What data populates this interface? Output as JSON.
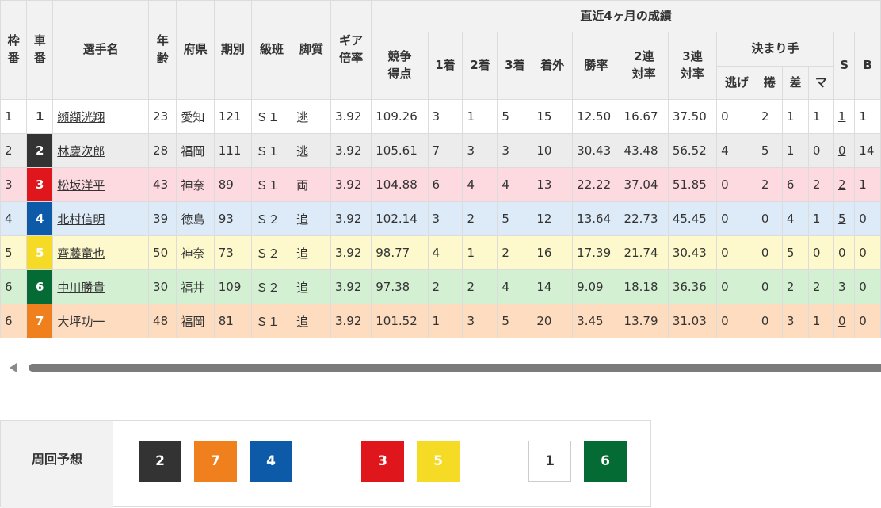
{
  "headers": {
    "waku": "枠番",
    "sha": "車番",
    "name": "選手名",
    "age": "年齢",
    "pref": "府県",
    "term": "期別",
    "class": "級班",
    "style": "脚質",
    "gear": "ギア倍率",
    "recent": "直近4ヶ月の成績",
    "score": "競争得点",
    "first": "1着",
    "second": "2着",
    "third": "3着",
    "out": "着外",
    "winrate": "勝率",
    "rentai2": "2連対率",
    "rentai3": "3連対率",
    "kimarite": "決まり手",
    "nige": "逃げ",
    "makuri": "捲",
    "sashi": "差",
    "mark": "マ",
    "s": "S",
    "b": "B"
  },
  "car_colors": {
    "1": {
      "bg": "#ffffff",
      "fg": "#333333"
    },
    "2": {
      "bg": "#333333",
      "fg": "#ffffff"
    },
    "3": {
      "bg": "#e0161d",
      "fg": "#ffffff"
    },
    "4": {
      "bg": "#0d5aa8",
      "fg": "#ffffff"
    },
    "5": {
      "bg": "#f5db25",
      "fg": "#ffffff"
    },
    "6": {
      "bg": "#046b34",
      "fg": "#ffffff"
    },
    "7": {
      "bg": "#f07f1d",
      "fg": "#ffffff"
    }
  },
  "riders": [
    {
      "waku": "1",
      "car": "1",
      "name": "纐纈洸翔",
      "age": "23",
      "pref": "愛知",
      "term": "121",
      "class": "Ｓ１",
      "style": "逃",
      "gear": "3.92",
      "score": "109.26",
      "first": "3",
      "second": "1",
      "third": "5",
      "out": "15",
      "winrate": "12.50",
      "r2": "16.67",
      "r3": "37.50",
      "nige": "0",
      "makuri": "2",
      "sashi": "1",
      "mark": "1",
      "s": "1",
      "b": "1"
    },
    {
      "waku": "2",
      "car": "2",
      "name": "林慶次郎",
      "age": "28",
      "pref": "福岡",
      "term": "111",
      "class": "Ｓ１",
      "style": "逃",
      "gear": "3.92",
      "score": "105.61",
      "first": "7",
      "second": "3",
      "third": "3",
      "out": "10",
      "winrate": "30.43",
      "r2": "43.48",
      "r3": "56.52",
      "nige": "4",
      "makuri": "5",
      "sashi": "1",
      "mark": "0",
      "s": "0",
      "b": "14"
    },
    {
      "waku": "3",
      "car": "3",
      "name": "松坂洋平",
      "age": "43",
      "pref": "神奈",
      "term": "89",
      "class": "Ｓ１",
      "style": "両",
      "gear": "3.92",
      "score": "104.88",
      "first": "6",
      "second": "4",
      "third": "4",
      "out": "13",
      "winrate": "22.22",
      "r2": "37.04",
      "r3": "51.85",
      "nige": "0",
      "makuri": "2",
      "sashi": "6",
      "mark": "2",
      "s": "2",
      "b": "1"
    },
    {
      "waku": "4",
      "car": "4",
      "name": "北村信明",
      "age": "39",
      "pref": "徳島",
      "term": "93",
      "class": "Ｓ２",
      "style": "追",
      "gear": "3.92",
      "score": "102.14",
      "first": "3",
      "second": "2",
      "third": "5",
      "out": "12",
      "winrate": "13.64",
      "r2": "22.73",
      "r3": "45.45",
      "nige": "0",
      "makuri": "0",
      "sashi": "4",
      "mark": "1",
      "s": "5",
      "b": "0"
    },
    {
      "waku": "5",
      "car": "5",
      "name": "齊藤竜也",
      "age": "50",
      "pref": "神奈",
      "term": "73",
      "class": "Ｓ２",
      "style": "追",
      "gear": "3.92",
      "score": "98.77",
      "first": "4",
      "second": "1",
      "third": "2",
      "out": "16",
      "winrate": "17.39",
      "r2": "21.74",
      "r3": "30.43",
      "nige": "0",
      "makuri": "0",
      "sashi": "5",
      "mark": "0",
      "s": "0",
      "b": "0"
    },
    {
      "waku": "6",
      "car": "6",
      "name": "中川勝貴",
      "age": "30",
      "pref": "福井",
      "term": "109",
      "class": "Ｓ２",
      "style": "追",
      "gear": "3.92",
      "score": "97.38",
      "first": "2",
      "second": "2",
      "third": "4",
      "out": "14",
      "winrate": "9.09",
      "r2": "18.18",
      "r3": "36.36",
      "nige": "0",
      "makuri": "0",
      "sashi": "2",
      "mark": "2",
      "s": "3",
      "b": "0"
    },
    {
      "waku": "6",
      "car": "7",
      "name": "大坪功一",
      "age": "48",
      "pref": "福岡",
      "term": "81",
      "class": "Ｓ１",
      "style": "追",
      "gear": "3.92",
      "score": "101.52",
      "first": "1",
      "second": "3",
      "third": "5",
      "out": "20",
      "winrate": "3.45",
      "r2": "13.79",
      "r3": "31.03",
      "nige": "0",
      "makuri": "0",
      "sashi": "3",
      "mark": "1",
      "s": "0",
      "b": "0"
    }
  ],
  "prediction": {
    "label": "周回予想",
    "order": [
      "2",
      "7",
      "4",
      "3",
      "5",
      "1",
      "6"
    ]
  }
}
